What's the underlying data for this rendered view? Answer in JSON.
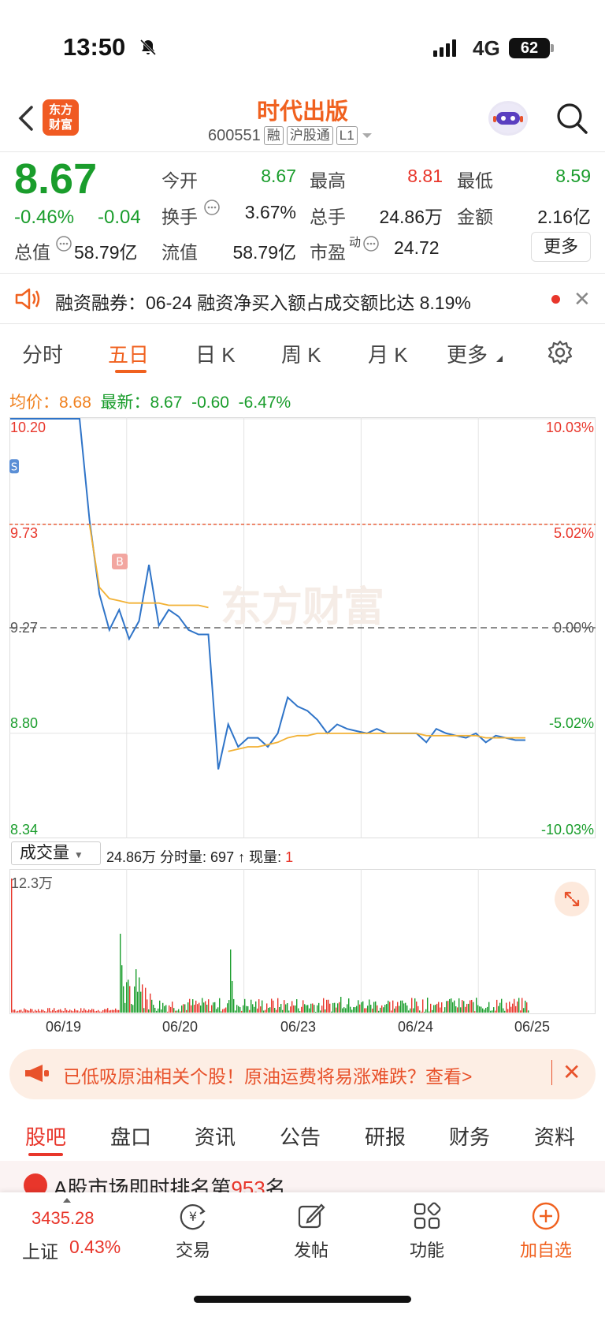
{
  "status": {
    "time": "13:50",
    "network": "4G",
    "battery": "62"
  },
  "header": {
    "logo": [
      "东方",
      "财富"
    ],
    "title": "时代出版",
    "code": "600551",
    "tags": [
      "融",
      "沪股通",
      "L1"
    ]
  },
  "quote": {
    "price": "8.67",
    "change_pct": "-0.46%",
    "change": "-0.04",
    "rows": [
      [
        {
          "label": "今开",
          "value": "8.67",
          "color": "green"
        },
        {
          "label": "最高",
          "value": "8.81",
          "color": "red"
        },
        {
          "label": "最低",
          "value": "8.59",
          "color": "green"
        }
      ],
      [
        {
          "label": "换手",
          "value": "3.67%",
          "color": "dark"
        },
        {
          "label": "总手",
          "value": "24.86万",
          "color": "dark"
        },
        {
          "label": "金额",
          "value": "2.16亿",
          "color": "dark"
        }
      ],
      [
        {
          "label": "总值",
          "value": "58.79亿",
          "color": "dark"
        },
        {
          "label": "流值",
          "value": "58.79亿",
          "color": "dark"
        },
        {
          "label": "市盈",
          "value": "24.72",
          "color": "dark"
        }
      ]
    ],
    "pe_sup": "动",
    "more": "更多"
  },
  "notice": {
    "text": "融资融券：06-24 融资净买入额占成交额比达 8.19%"
  },
  "chart_tabs": [
    "分时",
    "五日",
    "日 K",
    "周 K",
    "月 K",
    "更多"
  ],
  "active_tab": "五日",
  "chart_summary": {
    "avg_label": "均价：",
    "avg_value": "8.68",
    "last_label": "最新：",
    "last_value": "8.67",
    "last_change": "-0.60",
    "last_pct": "-6.47%"
  },
  "chart_data": {
    "type": "line",
    "title": "",
    "price_ticks": [
      "10.20",
      "9.73",
      "9.27",
      "8.80",
      "8.34"
    ],
    "pct_ticks": [
      "10.03%",
      "5.02%",
      "0.00%",
      "-5.02%",
      "-10.03%"
    ],
    "x_ticks": [
      "06/19",
      "06/20",
      "06/23",
      "06/24",
      "06/25"
    ],
    "ylim": [
      8.34,
      10.2
    ],
    "prev_close": 9.27,
    "markers": [
      "S",
      "B"
    ],
    "watermark": "东方财富",
    "series": [
      {
        "values": [
          10.2,
          10.2,
          10.2,
          10.2,
          10.2,
          10.2,
          10.2,
          10.2,
          9.75,
          9.42,
          9.26,
          9.35,
          9.22,
          9.3,
          9.55,
          9.28,
          9.35,
          9.32,
          9.26,
          9.24,
          9.24,
          8.64,
          8.84,
          8.74,
          8.78,
          8.78,
          8.74,
          8.8,
          8.96,
          8.92,
          8.9,
          8.86,
          8.8,
          8.84,
          8.82,
          8.81,
          8.8,
          8.82,
          8.8,
          8.8,
          8.8,
          8.8,
          8.76,
          8.82,
          8.8,
          8.79,
          8.78,
          8.8,
          8.76,
          8.79,
          8.78,
          8.77,
          8.77
        ]
      },
      {
        "values": [
          null,
          null,
          null,
          null,
          null,
          null,
          null,
          null,
          9.73,
          9.45,
          9.4,
          9.39,
          9.38,
          9.38,
          9.38,
          9.38,
          9.37,
          9.37,
          9.37,
          9.37,
          9.36,
          null,
          8.72,
          8.73,
          8.74,
          8.74,
          8.75,
          8.76,
          8.78,
          8.79,
          8.79,
          8.8,
          8.8,
          8.8,
          8.8,
          8.8,
          8.8,
          8.8,
          8.8,
          8.8,
          8.8,
          8.8,
          8.79,
          8.79,
          8.79,
          8.79,
          8.79,
          8.79,
          8.78,
          8.78,
          8.78,
          8.78,
          8.78
        ]
      }
    ]
  },
  "volume": {
    "selector": "成交量",
    "summary": "24.86万 分时量: 697 ↑ 现量:",
    "current": "1",
    "max_label": "12.3万"
  },
  "ad": {
    "text": "已低吸原油相关个股！原油运费将易涨难跌？查看>"
  },
  "bottom_tabs": [
    "股吧",
    "盘口",
    "资讯",
    "公告",
    "研报",
    "财务",
    "资料"
  ],
  "rank": {
    "prefix": "A股市场即时排名第",
    "rank": "953",
    "suffix": "名"
  },
  "index": {
    "value": "3435.28",
    "name": "上证",
    "pct": "0.43%"
  },
  "nav": [
    {
      "label": "交易",
      "icon": "trade-icon"
    },
    {
      "label": "发帖",
      "icon": "post-icon"
    },
    {
      "label": "功能",
      "icon": "function-icon"
    },
    {
      "label": "加自选",
      "icon": "add-watchlist-icon"
    }
  ]
}
